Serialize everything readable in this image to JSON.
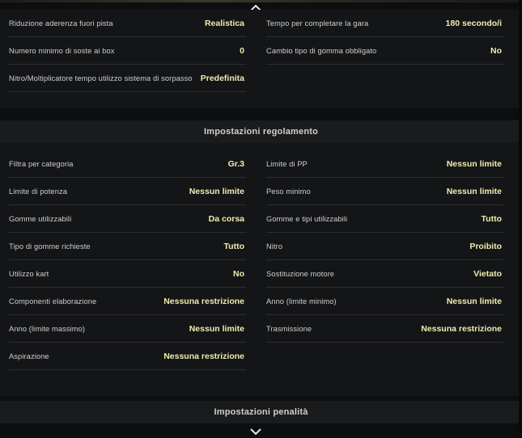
{
  "race_settings": {
    "left": [
      {
        "label": "Riduzione aderenza fuori pista",
        "value": "Realistica"
      },
      {
        "label": "Numero minimo di soste ai box",
        "value": "0"
      },
      {
        "label": "Nitro/Moltiplicatore tempo utilizzo sistema di sorpasso",
        "value": "Predefinita"
      }
    ],
    "right": [
      {
        "label": "Tempo per completare la gara",
        "value": "180 secondo/i"
      },
      {
        "label": "Cambio tipo di gomma obbligato",
        "value": "No"
      }
    ]
  },
  "regulation": {
    "title": "Impostazioni regolamento",
    "left": [
      {
        "label": "Filtra per categoria",
        "value": "Gr.3"
      },
      {
        "label": "Limite di potenza",
        "value": "Nessun limite"
      },
      {
        "label": "Gomme utilizzabili",
        "value": "Da corsa"
      },
      {
        "label": "Tipo di gomme richieste",
        "value": "Tutto"
      },
      {
        "label": "Utilizzo kart",
        "value": "No"
      },
      {
        "label": "Componenti elaborazione",
        "value": "Nessuna restrizione"
      },
      {
        "label": "Anno (limite massimo)",
        "value": "Nessun limite"
      },
      {
        "label": "Aspirazione",
        "value": "Nessuna restrizione"
      }
    ],
    "right": [
      {
        "label": "Limite di PP",
        "value": "Nessun limite"
      },
      {
        "label": "Peso minimo",
        "value": "Nessun limite"
      },
      {
        "label": "Gomme e tipi utilizzabili",
        "value": "Tutto"
      },
      {
        "label": "Nitro",
        "value": "Proibito"
      },
      {
        "label": "Sostituzione motore",
        "value": "Vietato"
      },
      {
        "label": "Anno (limite minimo)",
        "value": "Nessun limite"
      },
      {
        "label": "Trasmissione",
        "value": "Nessuna restrizione"
      }
    ]
  },
  "penalty": {
    "title": "Impostazioni penalità"
  },
  "icons": {
    "scroll_up": "chevron-up-icon",
    "scroll_down": "chevron-down-icon"
  },
  "colors": {
    "value_text": "#f1ecb0",
    "panel_bg": "#141517",
    "header_bg": "#1a1b1d",
    "divider": "#2c2e31"
  }
}
